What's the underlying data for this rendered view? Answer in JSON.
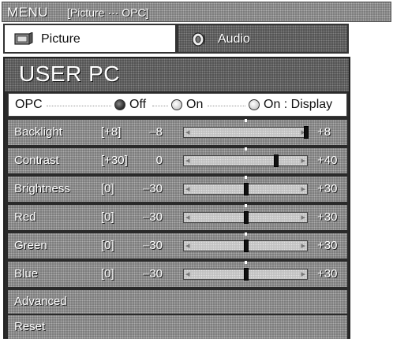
{
  "menu": {
    "title": "MENU",
    "breadcrumb": "[Picture ··· OPC]"
  },
  "tabs": [
    {
      "label": "Picture",
      "icon": "picture-icon",
      "selected": true
    },
    {
      "label": "Audio",
      "icon": "audio-icon",
      "selected": false
    }
  ],
  "panel": {
    "title": "USER PC",
    "opc": {
      "label": "OPC",
      "options": [
        {
          "label": "Off",
          "selected": true
        },
        {
          "label": "On",
          "selected": false
        },
        {
          "label": "On : Display",
          "selected": false
        }
      ]
    },
    "sliders": [
      {
        "label": "Backlight",
        "current": "[+8]",
        "min": "–8",
        "max": "+8",
        "value": 8,
        "range": [
          -8,
          8
        ]
      },
      {
        "label": "Contrast",
        "current": "[+30]",
        "min": "0",
        "max": "+40",
        "value": 30,
        "range": [
          0,
          40
        ]
      },
      {
        "label": "Brightness",
        "current": "[0]",
        "min": "–30",
        "max": "+30",
        "value": 0,
        "range": [
          -30,
          30
        ]
      },
      {
        "label": "Red",
        "current": "[0]",
        "min": "–30",
        "max": "+30",
        "value": 0,
        "range": [
          -30,
          30
        ]
      },
      {
        "label": "Green",
        "current": "[0]",
        "min": "–30",
        "max": "+30",
        "value": 0,
        "range": [
          -30,
          30
        ]
      },
      {
        "label": "Blue",
        "current": "[0]",
        "min": "–30",
        "max": "+30",
        "value": 0,
        "range": [
          -30,
          30
        ]
      }
    ],
    "advanced_label": "Advanced",
    "reset_label": "Reset"
  }
}
